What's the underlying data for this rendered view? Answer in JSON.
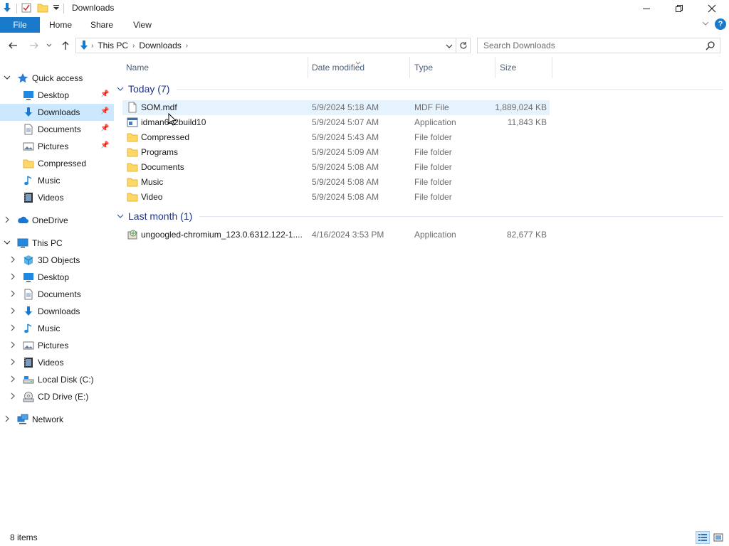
{
  "window": {
    "title": "Downloads",
    "minimize_label": "Minimize",
    "maximize_label": "Maximize",
    "close_label": "Close"
  },
  "ribbon": {
    "tabs": [
      {
        "label": "File"
      },
      {
        "label": "Home"
      },
      {
        "label": "Share"
      },
      {
        "label": "View"
      }
    ],
    "help_label": "?"
  },
  "address": {
    "crumbs": [
      "This PC",
      "Downloads"
    ]
  },
  "search": {
    "placeholder": "Search Downloads"
  },
  "columns": {
    "name": "Name",
    "date": "Date modified",
    "type": "Type",
    "size": "Size"
  },
  "sidebar": {
    "quick_access": {
      "label": "Quick access"
    },
    "quick_items": [
      {
        "label": "Desktop",
        "icon": "desktop-icon",
        "pinned": true
      },
      {
        "label": "Downloads",
        "icon": "downloads-icon",
        "pinned": true,
        "selected": true
      },
      {
        "label": "Documents",
        "icon": "documents-icon",
        "pinned": true
      },
      {
        "label": "Pictures",
        "icon": "pictures-icon",
        "pinned": true
      },
      {
        "label": "Compressed",
        "icon": "folder-icon",
        "pinned": false
      },
      {
        "label": "Music",
        "icon": "music-icon",
        "pinned": false
      },
      {
        "label": "Videos",
        "icon": "videos-icon",
        "pinned": false
      }
    ],
    "onedrive": {
      "label": "OneDrive"
    },
    "this_pc": {
      "label": "This PC"
    },
    "pc_items": [
      {
        "label": "3D Objects",
        "icon": "3d-objects-icon"
      },
      {
        "label": "Desktop",
        "icon": "desktop-icon"
      },
      {
        "label": "Documents",
        "icon": "documents-icon"
      },
      {
        "label": "Downloads",
        "icon": "downloads-icon"
      },
      {
        "label": "Music",
        "icon": "music-icon"
      },
      {
        "label": "Pictures",
        "icon": "pictures-icon"
      },
      {
        "label": "Videos",
        "icon": "videos-icon"
      },
      {
        "label": "Local Disk (C:)",
        "icon": "local-disk-icon"
      },
      {
        "label": "CD Drive (E:)",
        "icon": "cd-drive-icon"
      }
    ],
    "network": {
      "label": "Network"
    }
  },
  "groups": [
    {
      "label": "Today (7)",
      "files": [
        {
          "name": "SOM.mdf",
          "date": "5/9/2024 5:18 AM",
          "type": "MDF File",
          "size": "1,889,024 KB",
          "icon": "file-icon",
          "hover": true
        },
        {
          "name": "idman642build10",
          "date": "5/9/2024 5:07 AM",
          "type": "Application",
          "size": "11,843 KB",
          "icon": "application-icon"
        },
        {
          "name": "Compressed",
          "date": "5/9/2024 5:43 AM",
          "type": "File folder",
          "size": "",
          "icon": "folder-icon"
        },
        {
          "name": "Programs",
          "date": "5/9/2024 5:09 AM",
          "type": "File folder",
          "size": "",
          "icon": "folder-icon"
        },
        {
          "name": "Documents",
          "date": "5/9/2024 5:08 AM",
          "type": "File folder",
          "size": "",
          "icon": "folder-icon"
        },
        {
          "name": "Music",
          "date": "5/9/2024 5:08 AM",
          "type": "File folder",
          "size": "",
          "icon": "folder-icon"
        },
        {
          "name": "Video",
          "date": "5/9/2024 5:08 AM",
          "type": "File folder",
          "size": "",
          "icon": "folder-icon"
        }
      ]
    },
    {
      "label": "Last month (1)",
      "files": [
        {
          "name": "ungoogled-chromium_123.0.6312.122-1....",
          "date": "4/16/2024 3:53 PM",
          "type": "Application",
          "size": "82,677 KB",
          "icon": "installer-icon"
        }
      ]
    }
  ],
  "status": {
    "item_count": "8 items"
  },
  "colors": {
    "accent": "#1979ca",
    "selection": "#cce8ff",
    "hover": "#e5f3ff",
    "group_header": "#1e3287",
    "folder": "#ffd766"
  }
}
